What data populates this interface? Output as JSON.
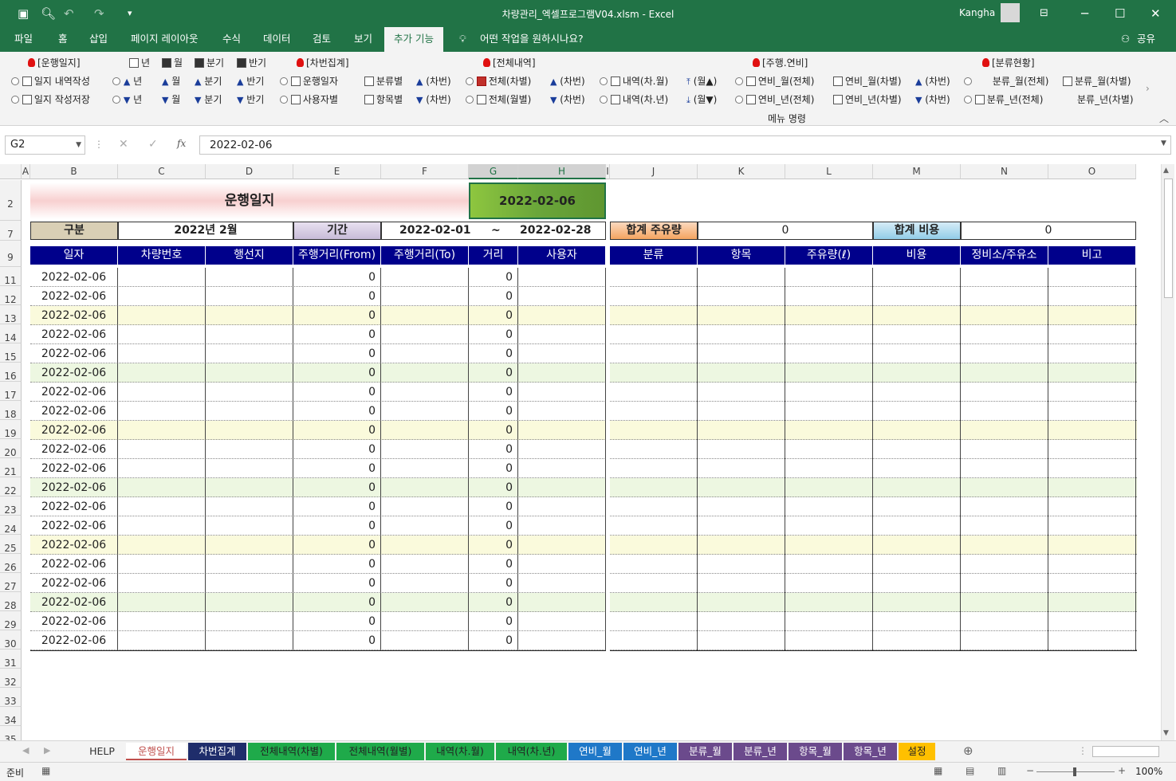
{
  "window": {
    "title": "차량관리_엑셀프로그램V04.xlsm  -  Excel",
    "user": "Kangha"
  },
  "ribbon_tabs": [
    "파일",
    "홈",
    "삽입",
    "페이지 레이아웃",
    "수식",
    "데이터",
    "검토",
    "보기",
    "추가 기능"
  ],
  "active_tab": "추가 기능",
  "tell_me": "어떤 작업을 원하시나요?",
  "share": "공유",
  "ribbon": {
    "group_label": "메뉴 명령",
    "sections": [
      "[운행일지]",
      "[차번집계]",
      "[전체내역]",
      "[주행.연비]",
      "[분류현황]"
    ],
    "row1": [
      "일지 내역작성",
      "년",
      "월",
      "분기",
      "반기",
      "운행일자",
      "분류별",
      "(차번)",
      "전체(차별)",
      "(차번)",
      "내역(차.월)",
      "(월▲)",
      "연비_월(전체)",
      "연비_월(차별)",
      "(차번)",
      "분류_월(전체)",
      "분류_월(차별)"
    ],
    "row0": [
      "년",
      "월",
      "분기",
      "반기"
    ],
    "row2": [
      "일지 작성저장",
      "년",
      "월",
      "분기",
      "반기",
      "사용자별",
      "항목별",
      "(차번)",
      "전체(월별)",
      "(차번)",
      "내역(차.년)",
      "(월▼)",
      "연비_년(전체)",
      "연비_년(차별)",
      "(차번)",
      "분류_년(전체)",
      "분류_년(차별)"
    ]
  },
  "formula": {
    "name_box": "G2",
    "fx": "fx",
    "value": "2022-02-06"
  },
  "columns": [
    "A",
    "B",
    "C",
    "D",
    "E",
    "F",
    "G",
    "H",
    "I",
    "J",
    "K",
    "L",
    "M",
    "N",
    "O"
  ],
  "selected_columns": [
    "G",
    "H"
  ],
  "sheet": {
    "title": "운행일지",
    "date_box": "2022-02-06",
    "label_gubun": "구분",
    "gubun_value": "2022년 2월",
    "label_period": "기간",
    "period_from": "2022-02-01",
    "period_tilde": "~",
    "period_to": "2022-02-28",
    "label_fuel_total": "합계 주유량",
    "fuel_total": "0",
    "label_cost_total": "합계 비용",
    "cost_total": "0",
    "left_headers": [
      "일자",
      "차량번호",
      "행선지",
      "주행거리(From)",
      "주행거리(To)",
      "거리",
      "사용자"
    ],
    "right_headers": [
      "분류",
      "항목",
      "주유량(ℓ)",
      "비용",
      "정비소/주유소",
      "비고"
    ],
    "row_numbers": [
      "2",
      "7",
      "9",
      "11",
      "12",
      "13",
      "14",
      "15",
      "16",
      "17",
      "18",
      "19",
      "20",
      "21",
      "22",
      "23",
      "24",
      "25",
      "26",
      "27",
      "28",
      "29",
      "30",
      "31",
      "32",
      "33",
      "34",
      "35"
    ],
    "data_rows": [
      {
        "date": "2022-02-06",
        "from": "0",
        "dist": "0"
      },
      {
        "date": "2022-02-06",
        "from": "0",
        "dist": "0"
      },
      {
        "date": "2022-02-06",
        "from": "0",
        "dist": "0"
      },
      {
        "date": "2022-02-06",
        "from": "0",
        "dist": "0"
      },
      {
        "date": "2022-02-06",
        "from": "0",
        "dist": "0"
      },
      {
        "date": "2022-02-06",
        "from": "0",
        "dist": "0"
      },
      {
        "date": "2022-02-06",
        "from": "0",
        "dist": "0"
      },
      {
        "date": "2022-02-06",
        "from": "0",
        "dist": "0"
      },
      {
        "date": "2022-02-06",
        "from": "0",
        "dist": "0"
      },
      {
        "date": "2022-02-06",
        "from": "0",
        "dist": "0"
      },
      {
        "date": "2022-02-06",
        "from": "0",
        "dist": "0"
      },
      {
        "date": "2022-02-06",
        "from": "0",
        "dist": "0"
      },
      {
        "date": "2022-02-06",
        "from": "0",
        "dist": "0"
      },
      {
        "date": "2022-02-06",
        "from": "0",
        "dist": "0"
      },
      {
        "date": "2022-02-06",
        "from": "0",
        "dist": "0"
      },
      {
        "date": "2022-02-06",
        "from": "0",
        "dist": "0"
      },
      {
        "date": "2022-02-06",
        "from": "0",
        "dist": "0"
      },
      {
        "date": "2022-02-06",
        "from": "0",
        "dist": "0"
      },
      {
        "date": "2022-02-06",
        "from": "0",
        "dist": "0"
      },
      {
        "date": "2022-02-06",
        "from": "0",
        "dist": "0"
      }
    ]
  },
  "sheet_tabs": [
    {
      "label": "HELP",
      "bg": "#f3f3f3",
      "fg": "#333"
    },
    {
      "label": "운행일지",
      "bg": "#ffffff",
      "fg": "#c0504d"
    },
    {
      "label": "차번집계",
      "bg": "#1f2d6b",
      "fg": "#ffffff"
    },
    {
      "label": "전체내역(차별)",
      "bg": "#1faa4a",
      "fg": "#222"
    },
    {
      "label": "전체내역(월별)",
      "bg": "#1faa4a",
      "fg": "#222"
    },
    {
      "label": "내역(차.월)",
      "bg": "#1faa4a",
      "fg": "#222"
    },
    {
      "label": "내역(차.년)",
      "bg": "#1faa4a",
      "fg": "#222"
    },
    {
      "label": "연비_월",
      "bg": "#1f78c8",
      "fg": "#ffffff"
    },
    {
      "label": "연비_년",
      "bg": "#1f78c8",
      "fg": "#ffffff"
    },
    {
      "label": "분류_월",
      "bg": "#6b4a8c",
      "fg": "#ffffff"
    },
    {
      "label": "분류_년",
      "bg": "#6b4a8c",
      "fg": "#ffffff"
    },
    {
      "label": "항목_월",
      "bg": "#6b4a8c",
      "fg": "#ffffff"
    },
    {
      "label": "항목_년",
      "bg": "#6b4a8c",
      "fg": "#ffffff"
    },
    {
      "label": "설정",
      "bg": "#ffc000",
      "fg": "#222"
    }
  ],
  "status": {
    "ready": "준비",
    "zoom": "100%"
  }
}
